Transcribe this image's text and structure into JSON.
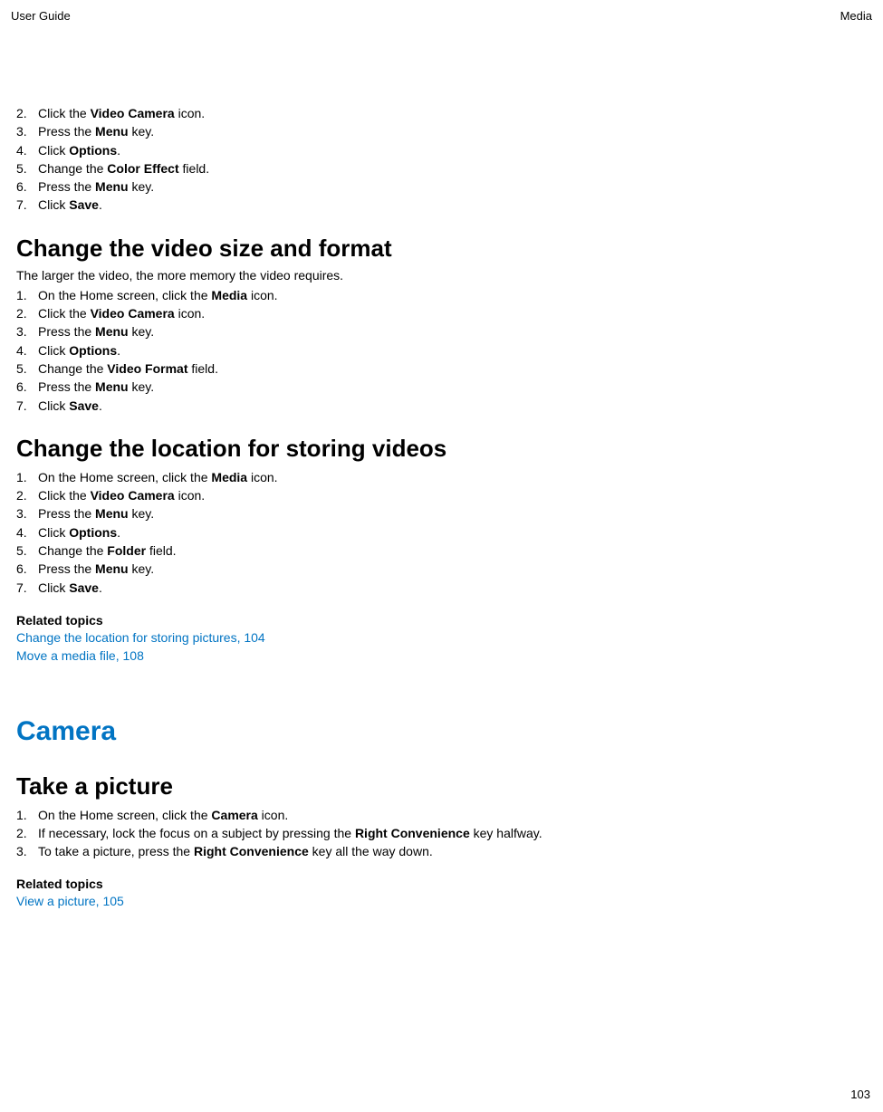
{
  "header": {
    "left": "User Guide",
    "right": "Media"
  },
  "sectionA": {
    "steps": [
      {
        "n": "2.",
        "pre": "Click the ",
        "bold": "Video Camera",
        "post": " icon."
      },
      {
        "n": "3.",
        "pre": "Press the ",
        "bold": "Menu",
        "post": " key."
      },
      {
        "n": "4.",
        "pre": "Click ",
        "bold": "Options",
        "post": "."
      },
      {
        "n": "5.",
        "pre": "Change the ",
        "bold": "Color Effect",
        "post": " field."
      },
      {
        "n": "6.",
        "pre": "Press the ",
        "bold": "Menu",
        "post": " key."
      },
      {
        "n": "7.",
        "pre": "Click ",
        "bold": "Save",
        "post": "."
      }
    ]
  },
  "sectionB": {
    "title": "Change the video size and format",
    "intro": "The larger the video, the more memory the video requires.",
    "steps": [
      {
        "n": "1.",
        "pre": "On the Home screen, click the ",
        "bold": "Media",
        "post": " icon."
      },
      {
        "n": "2.",
        "pre": "Click the ",
        "bold": "Video Camera",
        "post": " icon."
      },
      {
        "n": "3.",
        "pre": "Press the ",
        "bold": "Menu",
        "post": " key."
      },
      {
        "n": "4.",
        "pre": "Click ",
        "bold": "Options",
        "post": "."
      },
      {
        "n": "5.",
        "pre": "Change the ",
        "bold": "Video Format",
        "post": " field."
      },
      {
        "n": "6.",
        "pre": "Press the ",
        "bold": "Menu",
        "post": " key."
      },
      {
        "n": "7.",
        "pre": "Click ",
        "bold": "Save",
        "post": "."
      }
    ]
  },
  "sectionC": {
    "title": "Change the location for storing videos",
    "steps": [
      {
        "n": "1.",
        "pre": "On the Home screen, click the ",
        "bold": "Media",
        "post": " icon."
      },
      {
        "n": "2.",
        "pre": "Click the ",
        "bold": "Video Camera",
        "post": " icon."
      },
      {
        "n": "3.",
        "pre": "Press the ",
        "bold": "Menu",
        "post": " key."
      },
      {
        "n": "4.",
        "pre": "Click ",
        "bold": "Options",
        "post": "."
      },
      {
        "n": "5.",
        "pre": "Change the ",
        "bold": "Folder",
        "post": " field."
      },
      {
        "n": "6.",
        "pre": "Press the ",
        "bold": "Menu",
        "post": " key."
      },
      {
        "n": "7.",
        "pre": "Click ",
        "bold": "Save",
        "post": "."
      }
    ],
    "related_heading": "Related topics",
    "links": [
      "Change the location for storing pictures, 104",
      "Move a media file, 108"
    ]
  },
  "sectionD": {
    "h1": "Camera",
    "title": "Take a picture",
    "steps": [
      {
        "n": "1.",
        "pre": "On the Home screen, click the ",
        "bold": "Camera",
        "post": " icon."
      },
      {
        "n": "2.",
        "pre": "If necessary, lock the focus on a subject by pressing the ",
        "bold": "Right Convenience",
        "post": " key halfway."
      },
      {
        "n": "3.",
        "pre": "To take a picture, press the ",
        "bold": "Right Convenience",
        "post": " key all the way down."
      }
    ],
    "related_heading": "Related topics",
    "links": [
      "View a picture, 105"
    ]
  },
  "page_number": "103"
}
